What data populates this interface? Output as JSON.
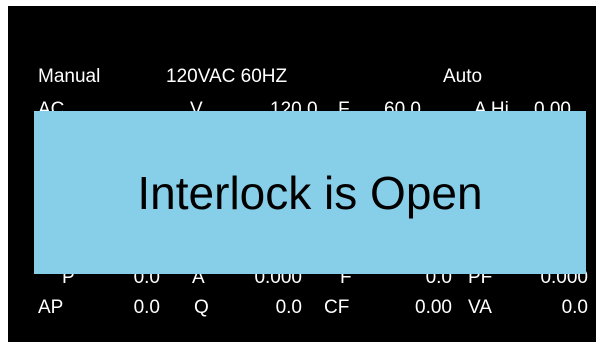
{
  "status": {
    "mode_left": "Manual",
    "supply": "120VAC 60HZ",
    "mode_right": "Auto"
  },
  "partial_row": {
    "label_ac": "AC",
    "label_v": "V",
    "value_v": "120.0",
    "label_f": "F",
    "value_f": "60.0",
    "label_a": "A Hi",
    "value_a": "0.00"
  },
  "power_row": {
    "label_p": "P",
    "value_p": "0.0",
    "label_a": "A",
    "value_a": "0.000",
    "label_f": "F",
    "value_f": "0.0",
    "label_pf": "PF",
    "value_pf": "0.000"
  },
  "apparent_row": {
    "label_ap": "AP",
    "value_ap": "0.0",
    "label_q": "Q",
    "value_q": "0.0",
    "label_cf": "CF",
    "value_cf": "0.00",
    "label_va": "VA",
    "value_va": "0.0"
  },
  "alert": {
    "message": "Interlock is Open",
    "background": "#87cee8"
  }
}
